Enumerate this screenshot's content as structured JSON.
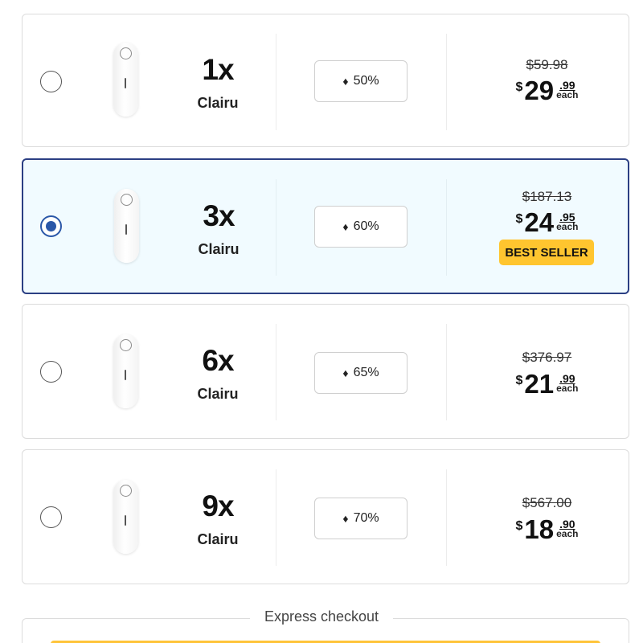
{
  "offers": [
    {
      "qty": "1x",
      "name": "Clairu",
      "discount": "50%",
      "old_price": "$59.98",
      "currency": "$",
      "whole": "29",
      "cents": ".99",
      "each": "each",
      "selected": false
    },
    {
      "qty": "3x",
      "name": "Clairu",
      "discount": "60%",
      "old_price": "$187.13",
      "currency": "$",
      "whole": "24",
      "cents": ".95",
      "each": "each",
      "selected": true,
      "badge": "BEST SELLER"
    },
    {
      "qty": "6x",
      "name": "Clairu",
      "discount": "65%",
      "old_price": "$376.97",
      "currency": "$",
      "whole": "21",
      "cents": ".99",
      "each": "each",
      "selected": false
    },
    {
      "qty": "9x",
      "name": "Clairu",
      "discount": "70%",
      "old_price": "$567.00",
      "currency": "$",
      "whole": "18",
      "cents": ".90",
      "each": "each",
      "selected": false
    }
  ],
  "express": {
    "label": "Express checkout"
  },
  "icons": {
    "discount": "tag-icon",
    "product": "product-device-image"
  },
  "colors": {
    "accent": "#2a57a8",
    "selected_border": "#2b3f83",
    "selected_bg": "#f1fbff",
    "best_seller": "#ffc52f"
  }
}
